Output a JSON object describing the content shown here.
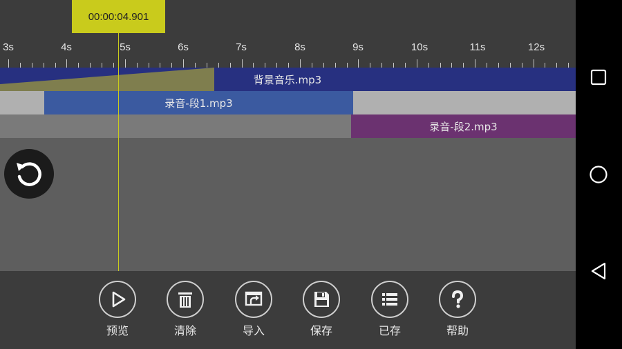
{
  "playhead": {
    "time": "00:00:04.901"
  },
  "ruler": {
    "labels": [
      "3s",
      "4s",
      "5s",
      "6s",
      "7s",
      "8s",
      "9s",
      "10s",
      "11s",
      "12s"
    ]
  },
  "tracks": {
    "background_music": {
      "label": "背景音乐.mp3",
      "color": "#273080"
    },
    "recording_1": {
      "label": "录音-段1.mp3",
      "color": "#3b5aa0"
    },
    "recording_2": {
      "label": "录音-段2.mp3",
      "color": "#6b3270"
    }
  },
  "toolbar": {
    "preview": "预览",
    "clear": "清除",
    "import": "导入",
    "save": "保存",
    "saved": "已存",
    "help": "帮助"
  },
  "colors": {
    "accent": "#c9cb1c",
    "background": "#3c3c3c",
    "canvas": "#5e5e5e"
  },
  "icons": {
    "undo": "undo-icon",
    "preview": "play-icon",
    "clear": "trash-icon",
    "import": "import-icon",
    "save": "floppy-icon",
    "saved": "list-icon",
    "help": "question-icon",
    "nav_recents": "square-icon",
    "nav_home": "circle-icon",
    "nav_back": "triangle-back-icon"
  }
}
